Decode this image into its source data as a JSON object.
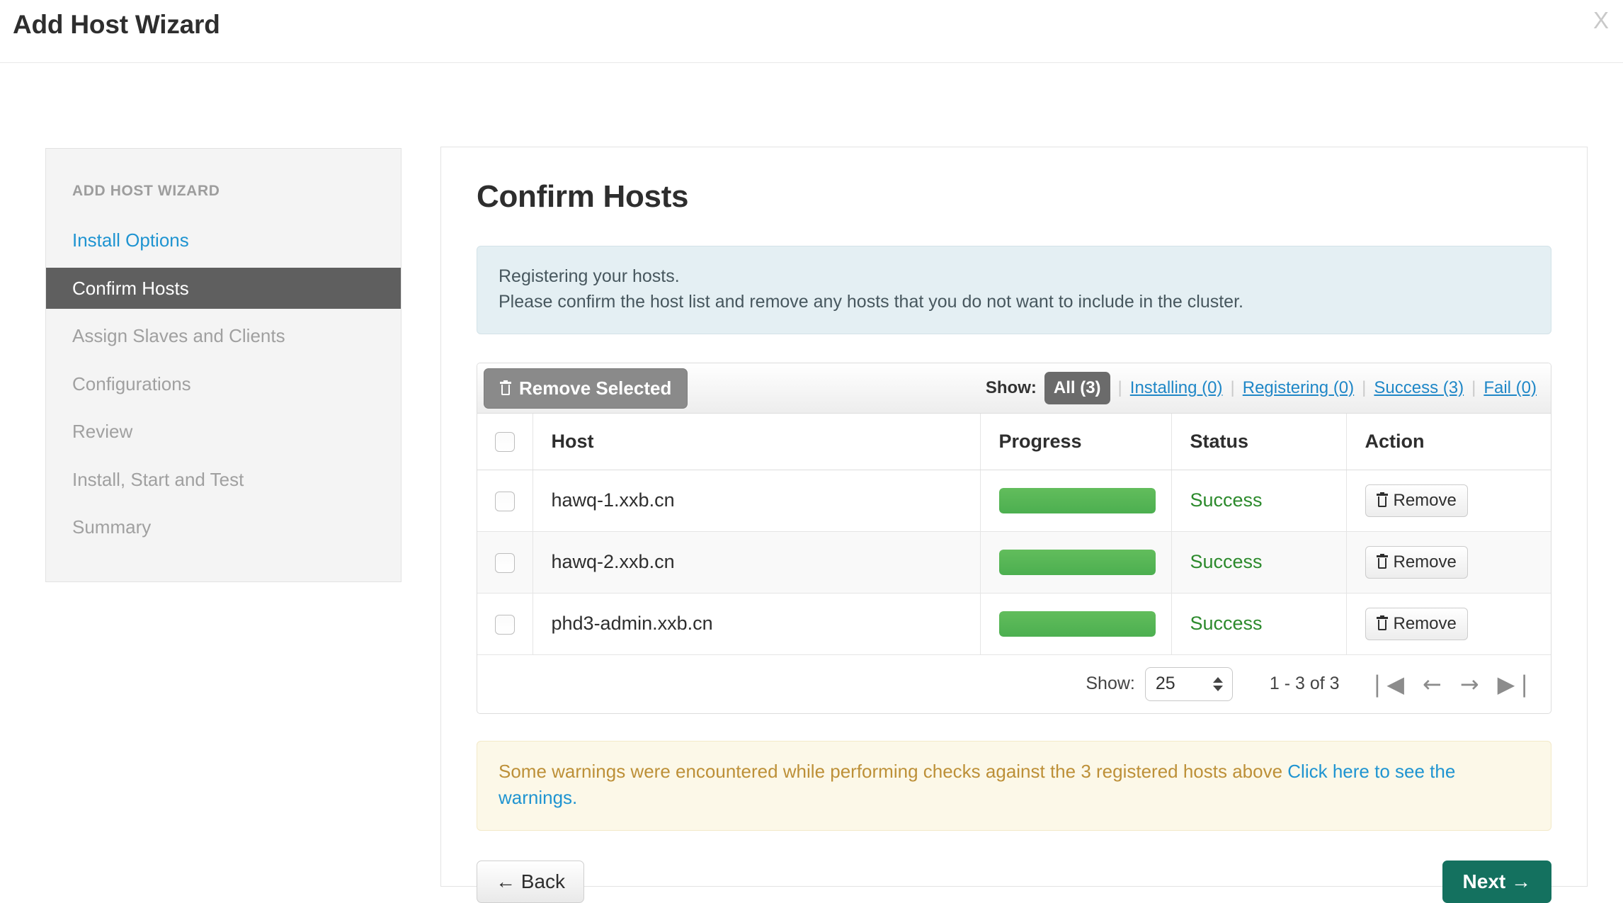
{
  "window": {
    "title": "Add Host Wizard",
    "close_label": "X"
  },
  "sidebar": {
    "heading": "ADD HOST WIZARD",
    "items": [
      {
        "label": "Install Options",
        "state": "link"
      },
      {
        "label": "Confirm Hosts",
        "state": "active"
      },
      {
        "label": "Assign Slaves and Clients",
        "state": "disabled"
      },
      {
        "label": "Configurations",
        "state": "disabled"
      },
      {
        "label": "Review",
        "state": "disabled"
      },
      {
        "label": "Install, Start and Test",
        "state": "disabled"
      },
      {
        "label": "Summary",
        "state": "disabled"
      }
    ]
  },
  "main": {
    "page_title": "Confirm Hosts",
    "info": {
      "line1": "Registering your hosts.",
      "line2": "Please confirm the host list and remove any hosts that you do not want to include in the cluster."
    },
    "toolbar": {
      "remove_selected_label": "Remove Selected",
      "show_label": "Show:",
      "filters": [
        {
          "label": "All (3)",
          "active": true
        },
        {
          "label": "Installing (0)",
          "active": false
        },
        {
          "label": "Registering (0)",
          "active": false
        },
        {
          "label": "Success (3)",
          "active": false
        },
        {
          "label": "Fail (0)",
          "active": false
        }
      ],
      "separator": "|"
    },
    "table": {
      "columns": [
        "Host",
        "Progress",
        "Status",
        "Action"
      ],
      "rows": [
        {
          "host": "hawq-1.xxb.cn",
          "progress": 100,
          "status": "Success",
          "action_label": "Remove",
          "checked": false
        },
        {
          "host": "hawq-2.xxb.cn",
          "progress": 100,
          "status": "Success",
          "action_label": "Remove",
          "checked": false
        },
        {
          "host": "phd3-admin.xxb.cn",
          "progress": 100,
          "status": "Success",
          "action_label": "Remove",
          "checked": false
        }
      ]
    },
    "pagination": {
      "show_label": "Show:",
      "page_size": "25",
      "range": "1 - 3 of 3",
      "first_icon": "❘◀",
      "prev_icon": "←",
      "next_icon": "→",
      "last_icon": "▶❘"
    },
    "warning": {
      "text": "Some warnings were encountered while performing checks against the 3 registered hosts above ",
      "link": "Click here to see the warnings."
    },
    "footer": {
      "back_label": "← Back",
      "next_label": "Next →"
    }
  },
  "colors": {
    "accent_link": "#1f94d1",
    "active_nav_bg": "#5f5f5f",
    "progress_green": "#4caf50",
    "status_success": "#2c8a2c",
    "next_button": "#14715f",
    "info_bg": "#e4eff3",
    "warn_bg": "#fcf8e8",
    "warn_text": "#bd9038"
  }
}
